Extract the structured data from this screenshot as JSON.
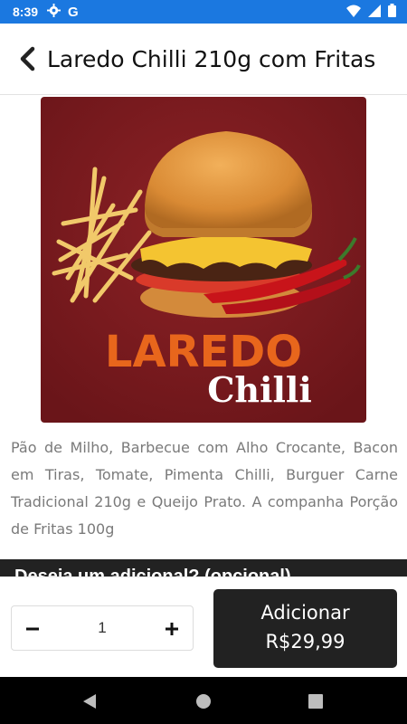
{
  "status_bar": {
    "time": "8:39",
    "g_icon": "G"
  },
  "header": {
    "title": "Laredo Chilli 210g com Fritas"
  },
  "product": {
    "image_text_top": "LAREDO",
    "image_text_bottom": "Chilli",
    "description": "Pão de Milho, Barbecue com Alho Crocante, Bacon em Tiras, Tomate, Pimenta Chilli, Burguer Carne Tradicional 210g e Queijo Prato. A companha Porção de Fritas 100g"
  },
  "section": {
    "label": "Deseja um adicional? (opcional)"
  },
  "order": {
    "quantity": "1",
    "add_label": "Adicionar",
    "price": "R$29,99"
  },
  "colors": {
    "status_bar": "#1b78e0",
    "dark": "#222222",
    "image_bg": "#7a1a1e",
    "brand_orange": "#e8661c"
  },
  "icons": [
    "gear-icon",
    "wifi-icon",
    "signal-icon",
    "battery-icon",
    "chevron-left-icon",
    "minus-icon",
    "plus-icon",
    "nav-back-icon",
    "nav-home-icon",
    "nav-recents-icon"
  ]
}
